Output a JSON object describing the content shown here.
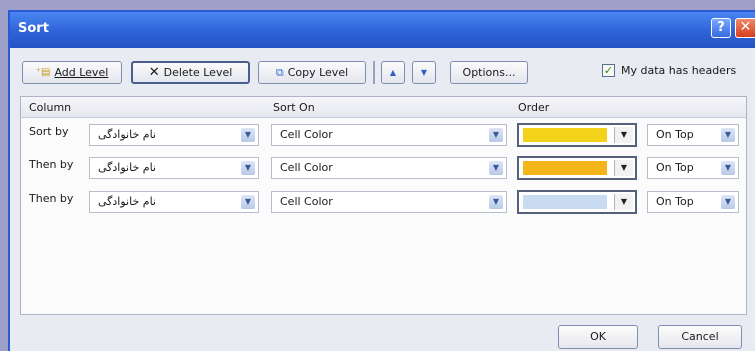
{
  "window": {
    "title": "Sort",
    "help": "?",
    "close": "✕"
  },
  "toolbar": {
    "add_level": "Add Level",
    "delete_level": "Delete Level",
    "copy_level": "Copy Level",
    "move_up": "▲",
    "move_down": "▼",
    "options": "Options...",
    "headers_label": "My data has headers",
    "headers_checked": true
  },
  "grid": {
    "headers": {
      "column": "Column",
      "sort_on": "Sort On",
      "order": "Order"
    },
    "rows": [
      {
        "label": "Sort by",
        "column": "نام خانوادگی",
        "sort_on": "Cell Color",
        "color": "#f2d21a",
        "position": "On Top"
      },
      {
        "label": "Then by",
        "column": "نام خانوادگی",
        "sort_on": "Cell Color",
        "color": "#f3b51b",
        "position": "On Top"
      },
      {
        "label": "Then by",
        "column": "نام خانوادگی",
        "sort_on": "Cell Color",
        "color": "#c9dbf0",
        "position": "On Top"
      }
    ]
  },
  "buttons": {
    "ok": "OK",
    "cancel": "Cancel"
  }
}
